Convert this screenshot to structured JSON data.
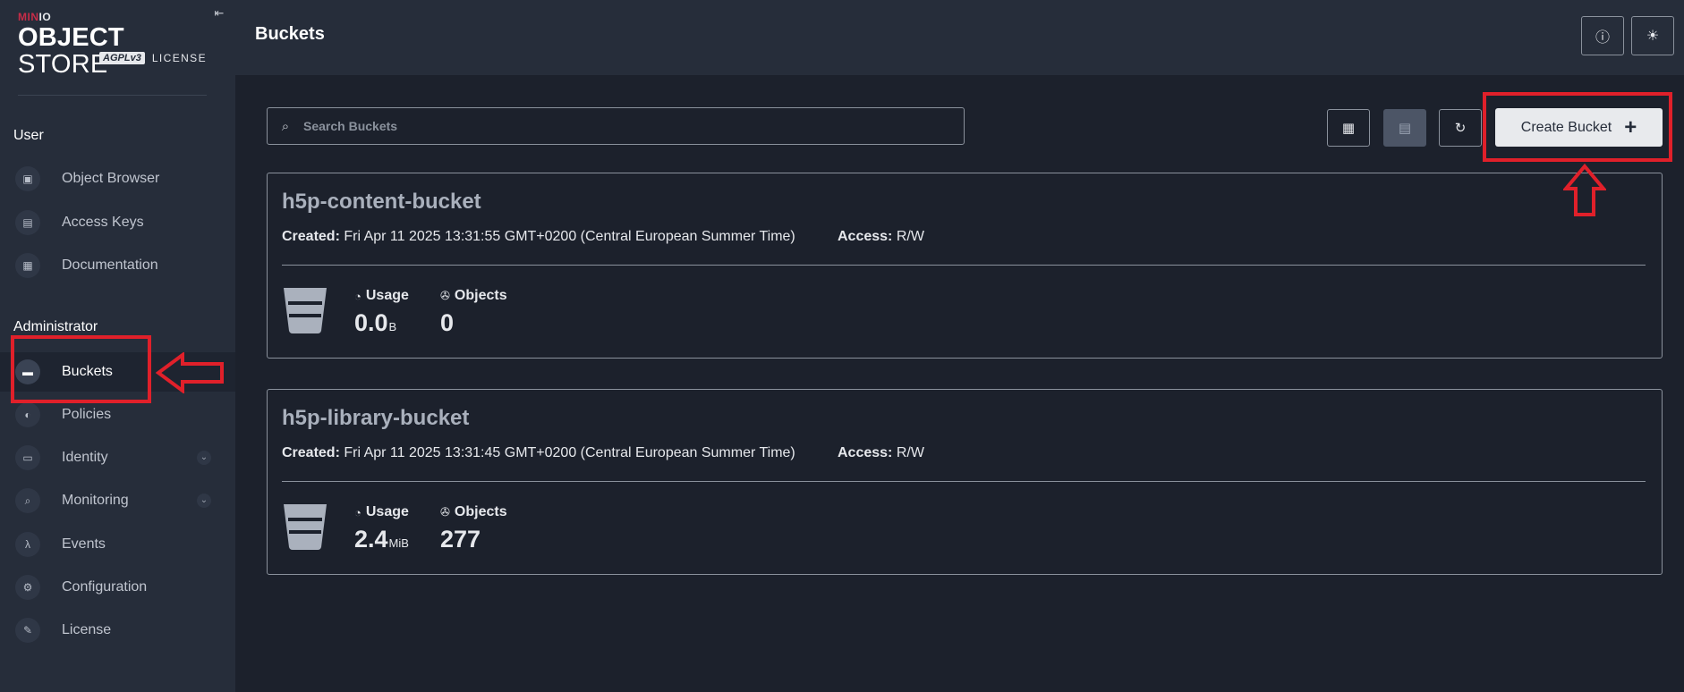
{
  "logo": {
    "brand_part1": "MIN",
    "brand_part2": "IO",
    "product_bold": "OBJECT",
    "product_rest": " STORE",
    "agpl": "AGPLv3",
    "license": "LICENSE"
  },
  "sidebar": {
    "user_section": "User",
    "user_items": [
      {
        "label": "Object Browser",
        "icon": "object-browser-icon"
      },
      {
        "label": "Access Keys",
        "icon": "access-keys-icon"
      },
      {
        "label": "Documentation",
        "icon": "documentation-icon"
      }
    ],
    "admin_section": "Administrator",
    "admin_items": [
      {
        "label": "Buckets",
        "icon": "bucket-icon",
        "active": true
      },
      {
        "label": "Policies",
        "icon": "policies-icon"
      },
      {
        "label": "Identity",
        "icon": "identity-icon",
        "expandable": true
      },
      {
        "label": "Monitoring",
        "icon": "monitoring-icon",
        "expandable": true
      },
      {
        "label": "Events",
        "icon": "lambda-icon"
      },
      {
        "label": "Configuration",
        "icon": "gear-icon"
      },
      {
        "label": "License",
        "icon": "license-icon"
      }
    ]
  },
  "header": {
    "title": "Buckets"
  },
  "toolbar": {
    "search_placeholder": "Search Buckets",
    "create_label": "Create Bucket"
  },
  "buckets": [
    {
      "name": "h5p-content-bucket",
      "created_label": "Created:",
      "created": "Fri Apr 11 2025 13:31:55 GMT+0200 (Central European Summer Time)",
      "access_label": "Access:",
      "access": "R/W",
      "usage_label": "Usage",
      "usage_value": "0.0",
      "usage_unit": "B",
      "objects_label": "Objects",
      "objects": "0"
    },
    {
      "name": "h5p-library-bucket",
      "created_label": "Created:",
      "created": "Fri Apr 11 2025 13:31:45 GMT+0200 (Central European Summer Time)",
      "access_label": "Access:",
      "access": "R/W",
      "usage_label": "Usage",
      "usage_value": "2.4",
      "usage_unit": "MiB",
      "objects_label": "Objects",
      "objects": "277"
    }
  ],
  "colors": {
    "sidebar_bg": "#262d3a",
    "main_bg": "#1c212c",
    "brand_red": "#c72c48",
    "annotation_red": "#e0202a"
  }
}
